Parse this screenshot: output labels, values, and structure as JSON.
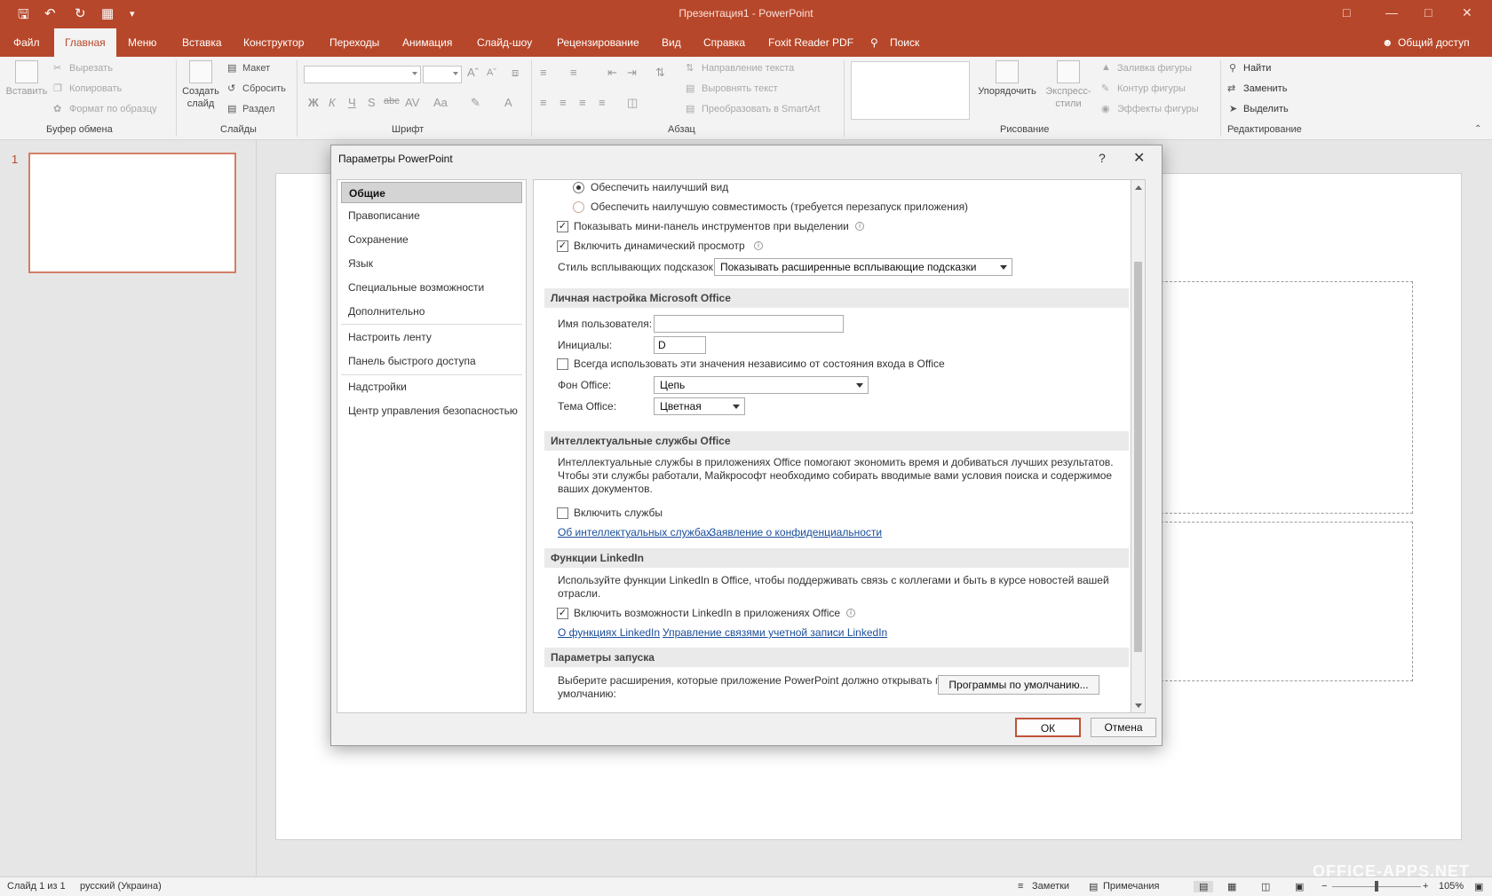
{
  "window": {
    "title": "Презентация1  -  PowerPoint"
  },
  "tabs": [
    "Файл",
    "Главная",
    "Меню",
    "Вставка",
    "Конструктор",
    "Переходы",
    "Анимация",
    "Слайд-шоу",
    "Рецензирование",
    "Вид",
    "Справка",
    "Foxit Reader PDF",
    "Поиск"
  ],
  "share": "Общий доступ",
  "ribbon": {
    "clipboard": {
      "paste": "Вставить",
      "cut": "Вырезать",
      "copy": "Копировать",
      "format": "Формат по образцу",
      "label": "Буфер обмена"
    },
    "slides": {
      "new": "Создать слайд",
      "layout": "Макет",
      "reset": "Сбросить",
      "section": "Раздел",
      "label": "Слайды"
    },
    "font": {
      "label": "Шрифт"
    },
    "paragraph": {
      "dir": "Направление текста",
      "align": "Выровнять текст",
      "smartart": "Преобразовать в SmartArt",
      "label": "Абзац"
    },
    "drawing": {
      "arrange": "Упорядочить",
      "styles": "Экспресс-стили",
      "fill": "Заливка фигуры",
      "outline": "Контур фигуры",
      "effects": "Эффекты фигуры",
      "label": "Рисование"
    },
    "editing": {
      "find": "Найти",
      "replace": "Заменить",
      "select": "Выделить",
      "label": "Редактирование"
    }
  },
  "thumbnail": {
    "number": "1"
  },
  "status": {
    "slide": "Слайд 1 из 1",
    "lang": "русский (Украина)",
    "notes": "Заметки",
    "comments": "Примечания",
    "zoom": "105%"
  },
  "watermark": "OFFICE-APPS.NET",
  "dialog": {
    "title": "Параметры PowerPoint",
    "help": "?",
    "categories": [
      "Общие",
      "Правописание",
      "Сохранение",
      "Язык",
      "Специальные возможности",
      "Дополнительно",
      "Настроить ленту",
      "Панель быстрого доступа",
      "Надстройки",
      "Центр управления безопасностью"
    ],
    "ui": {
      "radio_best": "Обеспечить наилучший вид",
      "radio_compat": "Обеспечить наилучшую совместимость (требуется перезапуск приложения)",
      "minitoolbar": "Показывать мини-панель инструментов при выделении",
      "livepreview": "Включить динамический просмотр",
      "tooltip_label": "Стиль всплывающих подсказок:",
      "tooltip_value": "Показывать расширенные всплывающие подсказки"
    },
    "personal": {
      "header": "Личная настройка Microsoft Office",
      "user_label": "Имя пользователя:",
      "user_value": "",
      "initials_label": "Инициалы:",
      "initials_value": "D",
      "always": "Всегда использовать эти значения независимо от состояния входа в Office",
      "bg_label": "Фон Office:",
      "bg_value": "Цепь",
      "theme_label": "Тема Office:",
      "theme_value": "Цветная"
    },
    "intel": {
      "header": "Интеллектуальные службы Office",
      "desc": "Интеллектуальные службы в приложениях Office помогают экономить время и добиваться лучших результатов. Чтобы эти службы работали, Майкрософт необходимо собирать вводимые вами условия поиска и содержимое ваших документов.",
      "enable": "Включить службы",
      "link1": "Об интеллектуальных службах",
      "link2": "Заявление о конфиденциальности"
    },
    "linkedin": {
      "header": "Функции LinkedIn",
      "desc": "Используйте функции LinkedIn в Office, чтобы поддерживать связь с коллегами и быть в курсе новостей вашей отрасли.",
      "enable": "Включить возможности LinkedIn в приложениях Office",
      "link1": "О функциях LinkedIn",
      "link2": "Управление связями учетной записи LinkedIn"
    },
    "startup": {
      "header": "Параметры запуска",
      "desc": "Выберите расширения, которые приложение PowerPoint должно открывать по умолчанию:",
      "button": "Программы по умолчанию..."
    },
    "ok": "ОК",
    "cancel": "Отмена"
  }
}
